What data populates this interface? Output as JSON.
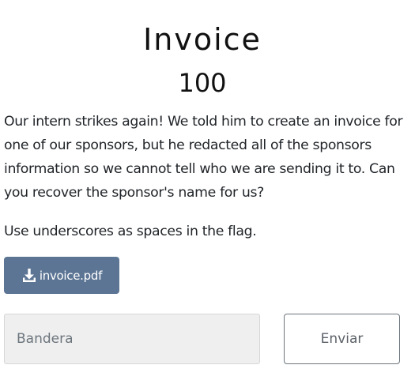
{
  "challenge": {
    "name": "Invoice",
    "points": "100",
    "description": "Our intern strikes again! We told him to create an invoice for one of our sponsors, but he redacted all of the sponsors information so we cannot tell who we are sending it to. Can you recover the sponsor's name for us?",
    "hint": "Use underscores as spaces in the flag.",
    "file": {
      "name": "invoice.pdf",
      "icon": "download-icon"
    }
  },
  "submission": {
    "placeholder": "Bandera",
    "value": "",
    "submit_label": "Enviar"
  },
  "colors": {
    "file_button": "#5c7594",
    "input_background": "#efefef",
    "submit_border": "#6c757d"
  }
}
